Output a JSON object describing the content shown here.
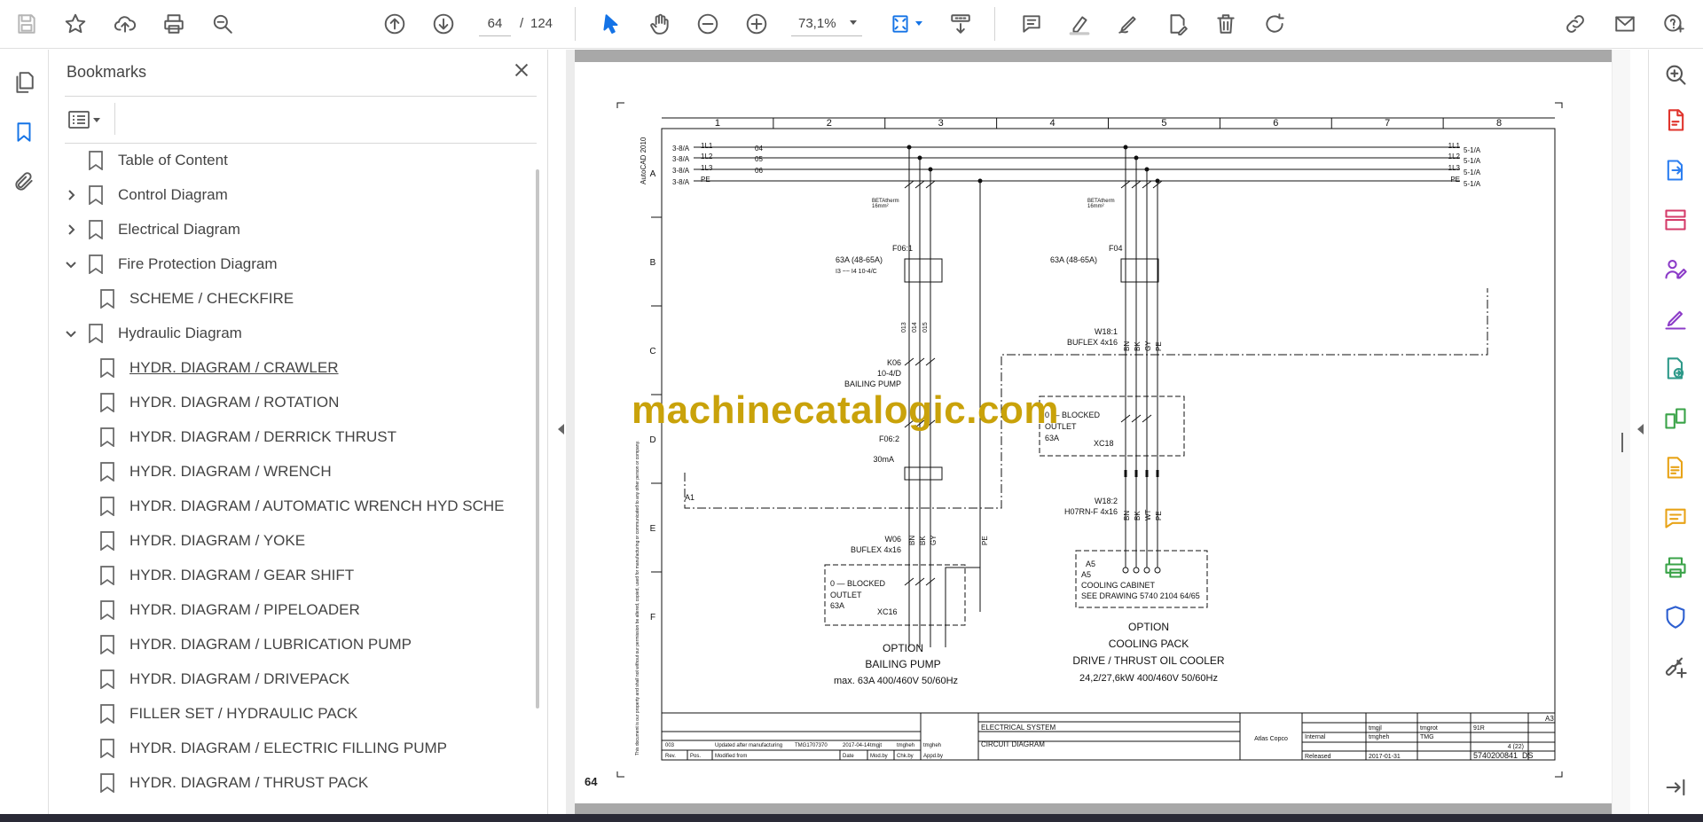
{
  "toolbar": {
    "page_current": "64",
    "page_separator": "/",
    "page_total": "124",
    "zoom": "73,1%",
    "icons": [
      "save-icon",
      "star-icon",
      "cloud-upload-icon",
      "print-icon",
      "find-icon",
      "page-up-icon",
      "page-down-icon",
      "select-cursor-icon",
      "hand-icon",
      "zoom-out-icon",
      "zoom-in-icon",
      "fit-page-icon",
      "scroll-mode-icon",
      "comment-icon",
      "highlight-icon",
      "draw-icon",
      "fill-sign-icon",
      "delete-icon",
      "rotate-icon",
      "share-link-icon",
      "email-icon",
      "help-icon"
    ]
  },
  "bookmarks_panel": {
    "title": "Bookmarks",
    "items": [
      {
        "label": "Table of Content",
        "level": 0,
        "expander": "none"
      },
      {
        "label": "Control Diagram",
        "level": 0,
        "expander": "collapsed"
      },
      {
        "label": "Electrical Diagram",
        "level": 0,
        "expander": "collapsed"
      },
      {
        "label": "Fire Protection Diagram",
        "level": 0,
        "expander": "expanded"
      },
      {
        "label": "SCHEME / CHECKFIRE",
        "level": 1,
        "expander": "none"
      },
      {
        "label": "Hydraulic Diagram",
        "level": 0,
        "expander": "expanded"
      },
      {
        "label": "HYDR. DIAGRAM / CRAWLER",
        "level": 1,
        "expander": "none",
        "selected": true
      },
      {
        "label": "HYDR. DIAGRAM / ROTATION",
        "level": 1,
        "expander": "none"
      },
      {
        "label": "HYDR. DIAGRAM / DERRICK THRUST",
        "level": 1,
        "expander": "none"
      },
      {
        "label": "HYDR. DIAGRAM / WRENCH",
        "level": 1,
        "expander": "none"
      },
      {
        "label": "HYDR. DIAGRAM / AUTOMATIC WRENCH HYD SCHE",
        "level": 1,
        "expander": "none"
      },
      {
        "label": "HYDR. DIAGRAM / YOKE",
        "level": 1,
        "expander": "none"
      },
      {
        "label": "HYDR. DIAGRAM / GEAR SHIFT",
        "level": 1,
        "expander": "none"
      },
      {
        "label": "HYDR. DIAGRAM / PIPELOADER",
        "level": 1,
        "expander": "none"
      },
      {
        "label": "HYDR. DIAGRAM / LUBRICATION PUMP",
        "level": 1,
        "expander": "none"
      },
      {
        "label": "HYDR. DIAGRAM / DRIVEPACK",
        "level": 1,
        "expander": "none"
      },
      {
        "label": "FILLER SET / HYDRAULIC PACK",
        "level": 1,
        "expander": "none"
      },
      {
        "label": "HYDR. DIAGRAM / ELECTRIC FILLING PUMP",
        "level": 1,
        "expander": "none"
      },
      {
        "label": "HYDR. DIAGRAM / THRUST PACK",
        "level": 1,
        "expander": "none"
      }
    ]
  },
  "document": {
    "page_number_label": "64",
    "watermark": "machinecatalogic.com",
    "columns": [
      "1",
      "2",
      "3",
      "4",
      "5",
      "6",
      "7",
      "8"
    ],
    "rows": [
      "A",
      "B",
      "C",
      "D",
      "E",
      "F"
    ],
    "cad_label": "AutoCAD 2010",
    "bus_left": [
      "3-8/A",
      "3-8/A",
      "3-8/A",
      "3-8/A"
    ],
    "bus_names": [
      "1L1",
      "1L2",
      "1L3",
      "PE"
    ],
    "bus_wires": [
      "04",
      "05",
      "06"
    ],
    "bus_right": [
      "5-1/A",
      "5-1/A",
      "5-1/A",
      "5-1/A"
    ],
    "bus_right_names": [
      "1L1",
      "1L2",
      "1L3",
      "PE"
    ],
    "left_circuit": {
      "betatherm": "BETAtherm",
      "cable_size": "16mm²",
      "breaker_id": "F06:1",
      "breaker_rating": "63A (48-65A)",
      "breaker_extra": "I3 ~~ I4 10-4/C",
      "wire_labels": [
        "013",
        "014",
        "015"
      ],
      "contactor_id": "K06",
      "contactor_ref": "10-4/D",
      "contactor_name": "BAILING PUMP",
      "rcd_id": "F06:2",
      "rcd_rating": "30mA",
      "area_label": "A1",
      "cable_id": "W06",
      "cable_type": "BUFLEX 4x16",
      "cable_cores": [
        "BN",
        "BK",
        "GY"
      ],
      "pe_label": "PE",
      "outlet_line1": "0 — BLOCKED",
      "outlet_line2": "OUTLET",
      "outlet_line3": "63A",
      "outlet_id": "XC16",
      "caption1": "OPTION",
      "caption2": "BAILING PUMP",
      "caption3": "max. 63A 400/460V 50/60Hz"
    },
    "right_circuit": {
      "betatherm": "BETAtherm",
      "cable_size": "16mm²",
      "breaker_id": "F04",
      "breaker_rating": "63A (48-65A)",
      "cable1_id": "W18:1",
      "cable1_type": "BUFLEX 4x16",
      "cable1_cores": [
        "BN",
        "BK",
        "GY",
        "PE"
      ],
      "outlet_line1": "0 — BLOCKED",
      "outlet_line2": "OUTLET",
      "outlet_line3": "63A",
      "outlet_id": "XC18",
      "cable2_id": "W18:2",
      "cable2_type": "H07RN-F 4x16",
      "cable2_cores": [
        "BN",
        "BK",
        "WT",
        "PE"
      ],
      "cabinet_id": "A5",
      "cabinet_line1": "COOLING CABINET",
      "cabinet_line2": "SEE DRAWING 5740 2104 64/65",
      "caption1": "OPTION",
      "caption2": "COOLING PACK",
      "caption3": "DRIVE / THRUST OIL COOLER",
      "caption4": "24,2/27,6kW 400/460V 50/60Hz"
    },
    "title_block": {
      "rev_row": [
        "003",
        "",
        "Updated after manufacturing",
        "TMG1707370",
        "2017-04-14",
        "tmgjt",
        "tmgheh",
        "tmgheh"
      ],
      "rev_header": [
        "Rev.",
        "Pos.",
        "Modified from",
        "",
        "Date",
        "Mod.by",
        "Chk.by",
        "Appd.by"
      ],
      "title1": "ELECTRICAL SYSTEM",
      "title2": "CIRCUIT DIAGRAM",
      "drawn": "tmgjl",
      "checked": "tmgheh",
      "approved": "tmgrot",
      "status": "Released",
      "date": "2017-01-31",
      "type": "91R",
      "sheet": "4 (22)",
      "doc_no": "5740200841_DS",
      "size": "A3",
      "confidentiality": "Internal",
      "company": "TMG",
      "owner": "Atlas Copco"
    },
    "disclaimer": "This document is our property and shall not without our permission be altered, copied, used for manufacturing or communicated to any other person or company."
  }
}
